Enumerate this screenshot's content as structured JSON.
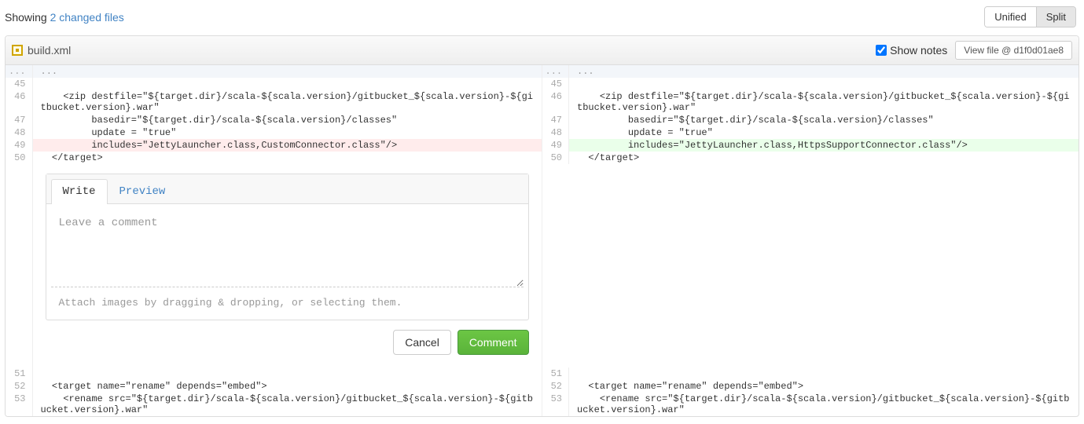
{
  "header": {
    "showing_prefix": "Showing ",
    "showing_link": "2 changed files",
    "view_unified": "Unified",
    "view_split": "Split"
  },
  "file": {
    "name": "build.xml",
    "show_notes_label": "Show notes",
    "view_file_label": "View file @ d1f0d01ae8"
  },
  "diff": {
    "hunk_marker": "...",
    "left": [
      {
        "n": "45",
        "t": ""
      },
      {
        "n": "46",
        "t": "    <zip destfile=\"${target.dir}/scala-${scala.version}/gitbucket_${scala.version}-${gitbucket.version}.war\""
      },
      {
        "n": "47",
        "t": "         basedir=\"${target.dir}/scala-${scala.version}/classes\""
      },
      {
        "n": "48",
        "t": "         update = \"true\""
      },
      {
        "n": "49",
        "t": "         includes=\"JettyLauncher.class,CustomConnector.class\"/>",
        "cls": "deletion"
      },
      {
        "n": "50",
        "t": "  </target>"
      }
    ],
    "right": [
      {
        "n": "45",
        "t": ""
      },
      {
        "n": "46",
        "t": "    <zip destfile=\"${target.dir}/scala-${scala.version}/gitbucket_${scala.version}-${gitbucket.version}.war\""
      },
      {
        "n": "47",
        "t": "         basedir=\"${target.dir}/scala-${scala.version}/classes\""
      },
      {
        "n": "48",
        "t": "         update = \"true\""
      },
      {
        "n": "49",
        "t": "         includes=\"JettyLauncher.class,HttpsSupportConnector.class\"/>",
        "cls": "addition"
      },
      {
        "n": "50",
        "t": "  </target>"
      }
    ],
    "left2": [
      {
        "n": "51",
        "t": ""
      },
      {
        "n": "52",
        "t": "  <target name=\"rename\" depends=\"embed\">"
      },
      {
        "n": "53",
        "t": "    <rename src=\"${target.dir}/scala-${scala.version}/gitbucket_${scala.version}-${gitbucket.version}.war\""
      }
    ],
    "right2": [
      {
        "n": "51",
        "t": ""
      },
      {
        "n": "52",
        "t": "  <target name=\"rename\" depends=\"embed\">"
      },
      {
        "n": "53",
        "t": "    <rename src=\"${target.dir}/scala-${scala.version}/gitbucket_${scala.version}-${gitbucket.version}.war\""
      }
    ]
  },
  "comment": {
    "tab_write": "Write",
    "tab_preview": "Preview",
    "placeholder": "Leave a comment",
    "attach_hint": "Attach images by dragging & dropping, or selecting them.",
    "cancel": "Cancel",
    "submit": "Comment"
  }
}
